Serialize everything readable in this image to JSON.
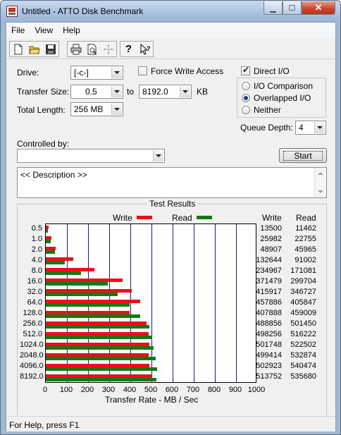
{
  "window": {
    "title": "Untitled - ATTO Disk Benchmark"
  },
  "menu": {
    "items": [
      "File",
      "View",
      "Help"
    ]
  },
  "controls": {
    "drive_label": "Drive:",
    "drive_value": "[-c-]",
    "force_write_label": "Force Write Access",
    "force_write_checked": false,
    "direct_io_label": "Direct I/O",
    "direct_io_checked": true,
    "transfer_size_label": "Transfer Size:",
    "transfer_from": "0.5",
    "to_label": "to",
    "transfer_to": "8192.0",
    "kb_label": "KB",
    "total_length_label": "Total Length:",
    "total_length_value": "256 MB",
    "io_mode_options": [
      "I/O Comparison",
      "Overlapped I/O",
      "Neither"
    ],
    "io_mode_selected": "Overlapped I/O",
    "queue_depth_label": "Queue Depth:",
    "queue_depth_value": "4",
    "controlled_by_label": "Controlled by:",
    "controlled_by_value": "",
    "start_label": "Start",
    "description_text": "<< Description >>"
  },
  "results": {
    "title": "Test Results",
    "legend": {
      "write": "Write",
      "read": "Read"
    },
    "col_headers": {
      "write": "Write",
      "read": "Read"
    }
  },
  "chart_data": {
    "type": "bar",
    "orientation": "horizontal",
    "title": "Test Results",
    "xlabel": "Transfer Rate - MB / Sec",
    "ylabel": "",
    "xlim": [
      0,
      1000
    ],
    "xticks": [
      "0",
      "100",
      "200",
      "300",
      "400",
      "500",
      "600",
      "700",
      "800",
      "900",
      "1000"
    ],
    "categories": [
      "0.5",
      "1.0",
      "2.0",
      "4.0",
      "8.0",
      "16.0",
      "32.0",
      "64.0",
      "128.0",
      "256.0",
      "512.0",
      "1024.0",
      "2048.0",
      "4096.0",
      "8192.0"
    ],
    "series": [
      {
        "name": "Write",
        "color": "#e8101a",
        "values": [
          13500,
          25982,
          48907,
          132644,
          234967,
          371479,
          415917,
          457886,
          407888,
          488856,
          498256,
          501748,
          499414,
          502923,
          513752
        ]
      },
      {
        "name": "Read",
        "color": "#127a12",
        "values": [
          11462,
          22755,
          45965,
          91002,
          171081,
          299704,
          346727,
          405847,
          459009,
          501450,
          516222,
          522502,
          532874,
          540474,
          535680
        ]
      }
    ],
    "units_note": "values in KB/sec"
  },
  "status": {
    "text": "For Help, press F1"
  },
  "colors": {
    "write": "#e8101a",
    "read": "#127a12",
    "grid": "#1a1a8c"
  }
}
